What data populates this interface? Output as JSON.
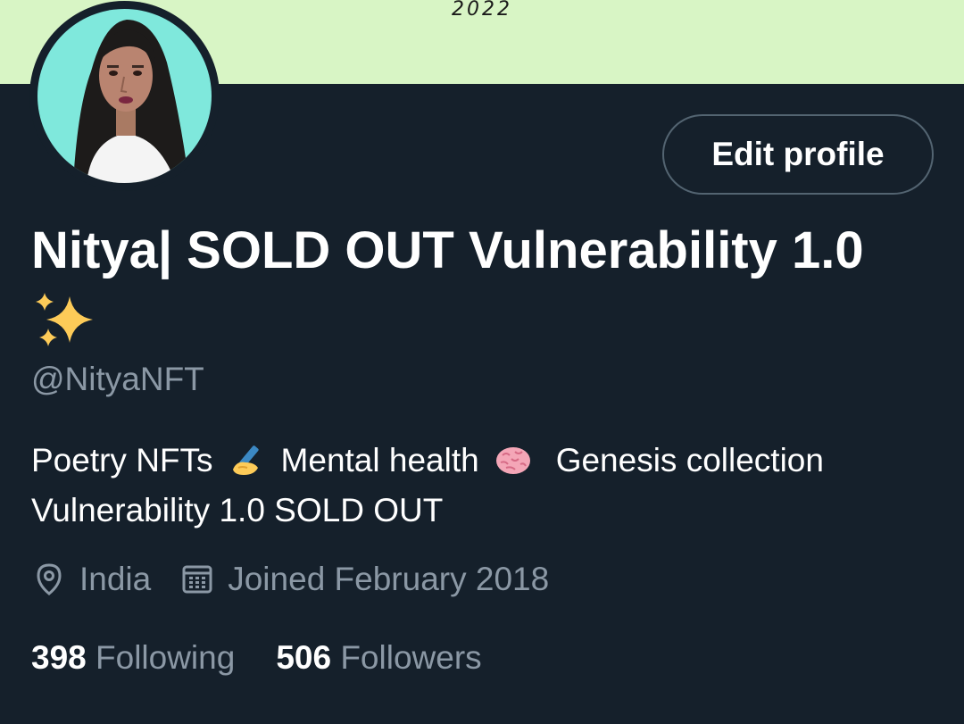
{
  "banner": {
    "year_text": "2022",
    "bg_color": "#d8f5c5"
  },
  "profile": {
    "display_name": "Nitya| SOLD OUT Vulnerability 1.0",
    "name_emoji": "sparkles-icon",
    "handle": "@NityaNFT",
    "edit_button_label": "Edit profile",
    "bio": {
      "part1": "Poetry NFTs",
      "part2": "Mental health",
      "part3": "Genesis collection",
      "line2": "Vulnerability 1.0 SOLD OUT"
    },
    "location": "India",
    "joined": "Joined February 2018",
    "following_count": "398",
    "following_label": "Following",
    "followers_count": "506",
    "followers_label": "Followers"
  },
  "colors": {
    "background": "#15202b",
    "secondary_text": "#8b98a5",
    "border": "#536471"
  }
}
